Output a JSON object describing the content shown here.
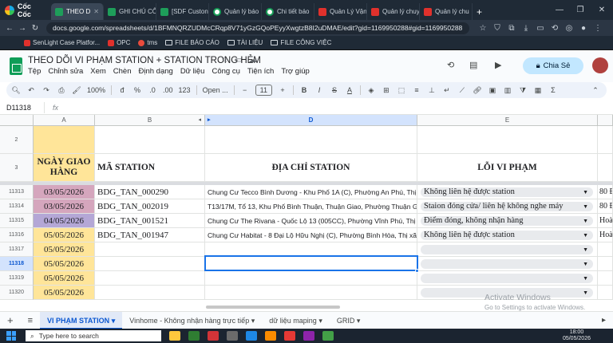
{
  "browser": {
    "brand": "Cốc Cốc",
    "tabs": [
      {
        "label": "THEO D",
        "icon": "sheets-icon",
        "active": true
      },
      {
        "label": "GHI CHÚ CÔ",
        "icon": "sheets-icon"
      },
      {
        "label": "[SDF Custon",
        "icon": "sheets-icon"
      },
      {
        "label": "Quản lý báo",
        "icon": "green-circle-icon"
      },
      {
        "label": "Chi tiết báo",
        "icon": "green-circle-icon"
      },
      {
        "label": "Quản Lý Vận",
        "icon": "red-app-icon"
      },
      {
        "label": "Quản lý chuy",
        "icon": "red-app-icon"
      },
      {
        "label": "Quản lý chu",
        "icon": "red-app-icon"
      }
    ],
    "url": "docs.google.com/spreadsheets/d/1BFMNQRZUDMcCRqp8V71yGzGQoPEyyXwgtzB8I2uDMAE/edit?gid=1169950288#gid=1169950288",
    "bookmarks": [
      "SenLight Case Platfor...",
      "OPC",
      "tms",
      "FILE BÁO CÁO",
      "TÀI LIỆU",
      "FILE CÔNG VIỆC"
    ]
  },
  "sheets": {
    "title": "THEO DÕI VI PHẠM STATION + STATION TRONG HẺM",
    "menu": [
      "Tệp",
      "Chỉnh sửa",
      "Xem",
      "Chèn",
      "Định dạng",
      "Dữ liệu",
      "Công cụ",
      "Tiện ích",
      "Trợ giúp"
    ],
    "share_label": "Chia Sẻ",
    "zoom": "100%",
    "font": "Open ...",
    "font_size": "11",
    "number_format": "123",
    "name_box": "D11318",
    "fx": "fx"
  },
  "grid": {
    "columns": [
      "A",
      "B",
      "",
      "D",
      "E",
      ""
    ],
    "header_rows": [
      "2",
      "3"
    ],
    "headers": {
      "date": "NGÀY GIAO HÀNG",
      "station": "MÃ STATION",
      "address": "ĐỊA CHỈ STATION",
      "violation": "LỖI VI PHẠM"
    },
    "rows": [
      {
        "num": "11313",
        "date": "03/05/2026",
        "station": "BDG_TAN_000290",
        "address": "Chung Cư Tecco Bình Dương - Khu Phố 1A (C), Phường An Phú, Thị xã",
        "violation": "Không liên hệ được station",
        "extra": "80 Đ"
      },
      {
        "num": "11314",
        "date": "03/05/2026",
        "station": "BDG_TAN_002019",
        "address": "T13/17M, Tổ 13, Khu Phố Bình Thuận, Thuận Giao, Phường Thuận Gia",
        "violation": "Staion đóng cửa/ liên hệ không nghe máy",
        "extra": "80 Đ"
      },
      {
        "num": "11315",
        "date": "04/05/2026",
        "station": "BDG_TAN_001521",
        "address": "Chung Cư The Rivana - Quốc Lộ 13 (005CC), Phường Vĩnh Phú, Thị xã",
        "violation": "Điểm đóng, không nhận hàng",
        "extra": "Hoà"
      },
      {
        "num": "11316",
        "date": "05/05/2026",
        "station": "BDG_TAN_001947",
        "address": "Chung Cư Habitat - 8 Đại Lộ Hữu Nghị (C), Phường Bình Hòa, Thị xã T",
        "violation": "Không liên hệ được station",
        "extra": "Hoà"
      },
      {
        "num": "11317",
        "date": "05/05/2026",
        "station": "",
        "address": "",
        "violation": "",
        "extra": ""
      },
      {
        "num": "11318",
        "date": "05/05/2026",
        "station": "",
        "address": "",
        "violation": "",
        "extra": ""
      },
      {
        "num": "11319",
        "date": "05/05/2026",
        "station": "",
        "address": "",
        "violation": "",
        "extra": ""
      },
      {
        "num": "11320",
        "date": "05/05/2026",
        "station": "",
        "address": "",
        "violation": "",
        "extra": ""
      }
    ]
  },
  "sheet_tabs": [
    "VI PHẠM STATION",
    "Vinhome - Không nhận hàng trực tiếp",
    "dữ liệu maping",
    "GRID"
  ],
  "watermark": {
    "title": "Activate Windows",
    "subtitle": "Go to Settings to activate Windows."
  },
  "taskbar": {
    "search_placeholder": "Type here to search",
    "time": "18:00",
    "date": "05/05/2026"
  },
  "colors": {
    "pink_date": "#d5a6bd",
    "purple_date": "#b4a7d6",
    "yellow_date": "#ffe599",
    "selection": "#1a73e8"
  }
}
